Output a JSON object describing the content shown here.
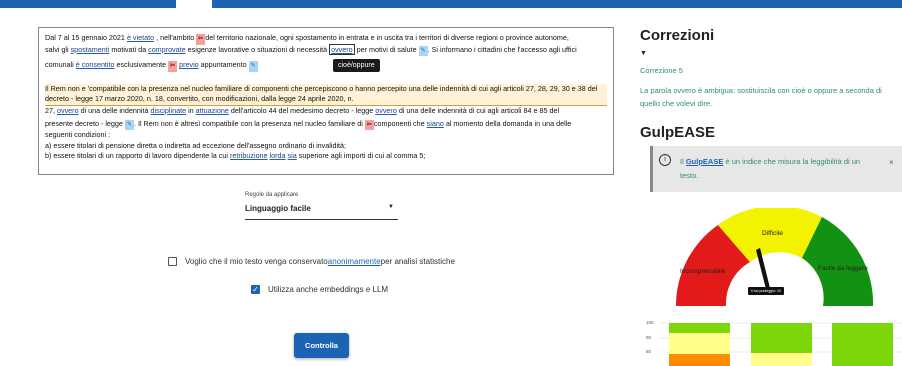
{
  "editor": {
    "line1": [
      "Dal 7 al 15 gennaio 2021 ",
      "è vietato",
      " , nell'ambito ",
      "del territorio nazionale, ogni spostamento in entrata e in uscita tra i territori di diverse regioni o province autonome,"
    ],
    "line2": [
      "salvi gli ",
      "spostamenti",
      " motivati da ",
      "comprovate",
      " esigenze lavorative o situazioni di necessità ",
      "ovvero",
      " per motivi di salute ",
      ". Si informano i cittadini che l'accesso agli uffici"
    ],
    "line3": [
      "comunali ",
      "è consentito",
      " esclusivamente ",
      "previo",
      " appuntamento"
    ],
    "para2": "Il Rem non e 'compatibile con la presenza nel nucleo familiare di componenti che percepiscono o hanno percepito una delle indennità di cui agli articoli 27, 28, 29, 30 e 38 del decreto - legge 17 marzo 2020, n. 18, convertito, con modificazioni, dalla legge 24 aprile 2020, n.",
    "line5": [
      "27, ",
      "ovvero",
      " di una delle indennità ",
      "disciplinate",
      " in ",
      "attuazione",
      " dell'articolo 44 del medesimo decreto - legge ",
      "ovvero",
      " di una delle indennità di cui agli articoli 84 e 85 del"
    ],
    "line6": [
      "presente decreto - legge ",
      ". Il Rem non è altresì compatibile con la presenza nel nucleo familiare di ",
      "componenti che ",
      "siano",
      " al momento della domanda in una delle"
    ],
    "line7": "seguenti condizioni :",
    "line8": "a) essere titolari di pensione diretta o indiretta ad eccezione dell'assegno ordinario di invalidità;",
    "line9": [
      "b) essere titolari di un rapporto di lavoro dipendente la cui ",
      "retribuzione",
      " ",
      "lorda",
      " ",
      "sia",
      " superiore agli importi di cui al comma 5;"
    ],
    "mark_cut": "✂",
    "mark_edit": "✎",
    "tooltip": "cioè/oppure"
  },
  "rules": {
    "label": "Regole da applicare",
    "value": "Linguaggio facile",
    "caret": "▼"
  },
  "checkbox1": {
    "before": "Voglio che il mio testo venga conservato ",
    "link": "anonimamente",
    "after": " per analisi statistiche",
    "checked": false
  },
  "checkbox2": {
    "label": "Utilizza anche embeddings e LLM",
    "checked": true,
    "check_glyph": "✓"
  },
  "submit_label": "Controlla",
  "correzioni": {
    "title": "Correzioni",
    "toggle": "▼",
    "item_title": "Correzione 5",
    "item_text": "La parola ovvero è ambigua: sostituiscila con cioè o oppure a seconda di quello che volevi dire."
  },
  "gulpease": {
    "title": "GulpEASE",
    "info_icon": "i",
    "info_prefix": "Il ",
    "info_link": "GulpEASE",
    "info_suffix": " è un indice che misura la leggibilità di un testo.",
    "close": "×",
    "gauge_labels": [
      "Incomprensibile",
      "Difficile",
      "Facile da leggere"
    ],
    "gauge_colors": [
      "#e31a1a",
      "#f3f300",
      "#129112"
    ],
    "score_label": "Il tuo punteggio: 43",
    "score": 43
  },
  "bar_chart": {
    "ticks": [
      "100",
      "90",
      "80"
    ],
    "colors": {
      "red": "#ff8c00",
      "yellow": "#ffff8a",
      "green": "#7dd60a",
      "lightgreen": "#9ae33e"
    }
  }
}
